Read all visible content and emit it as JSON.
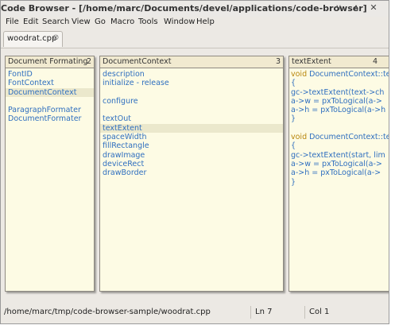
{
  "window": {
    "title": "Code Browser - [/home/marc/Documents/devel/applications/code-browser]",
    "minimize": "∨",
    "maximize": "∧",
    "close": "✕"
  },
  "menu": [
    "File",
    "Edit",
    "Search",
    "View",
    "Go",
    "Macro",
    "Tools",
    "Window",
    "Help"
  ],
  "tab": {
    "label": "woodrat.cpp",
    "close": "⊘"
  },
  "panes": [
    {
      "title": "Document Formating",
      "number": "2",
      "items": [
        "FontID",
        "FontContext",
        "DocumentContext",
        "",
        "ParagraphFormater",
        "DocumentFormater"
      ],
      "selected_index": 2
    },
    {
      "title": "DocumentContext",
      "number": "3",
      "items": [
        "description",
        "initialize - release",
        "",
        "configure",
        "",
        "textOut",
        "textExtent",
        "spaceWidth",
        "fillRectangle",
        "drawImage",
        "deviceRect",
        "drawBorder"
      ],
      "selected_index": 6
    },
    {
      "title": "textExtent",
      "number": "4",
      "code": [
        [
          {
            "t": "void ",
            "c": "kw"
          },
          {
            "t": "DocumentContext::te",
            "c": "id"
          }
        ],
        [
          {
            "t": "{",
            "c": "id"
          }
        ],
        [
          {
            "t": "  gc->textExtent(text->ch",
            "c": "id"
          }
        ],
        [
          {
            "t": "  a->w = pxToLogical(a->",
            "c": "id"
          }
        ],
        [
          {
            "t": "  a->h = pxToLogical(a->h",
            "c": "id"
          }
        ],
        [
          {
            "t": "}",
            "c": "id"
          }
        ],
        [],
        [
          {
            "t": "void ",
            "c": "kw"
          },
          {
            "t": "DocumentContext::te",
            "c": "id"
          }
        ],
        [
          {
            "t": "{",
            "c": "id"
          }
        ],
        [
          {
            "t": "  gc->textExtent(start, lim",
            "c": "id"
          }
        ],
        [
          {
            "t": "  a->w = pxToLogical(a->",
            "c": "id"
          }
        ],
        [
          {
            "t": "  a->h = pxToLogical(a->",
            "c": "id"
          }
        ],
        [
          {
            "t": "}",
            "c": "id"
          }
        ]
      ]
    }
  ],
  "status": {
    "path": "/home/marc/tmp/code-browser-sample/woodrat.cpp",
    "line": "Ln 7",
    "col": "Col 1"
  }
}
